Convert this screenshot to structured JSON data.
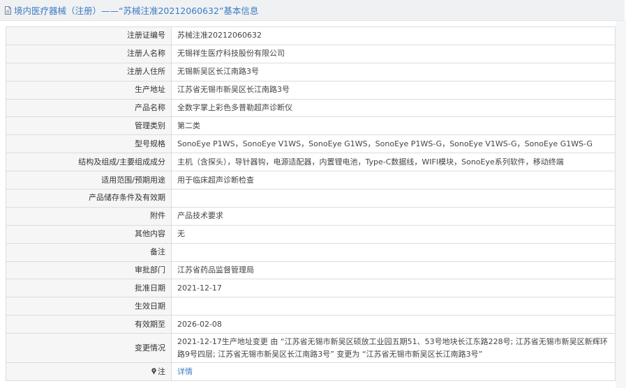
{
  "header": {
    "title": "境内医疗器械（注册）——“苏械注准20212060632”基本信息"
  },
  "rows": [
    {
      "label": "注册证编号",
      "value": "苏械注准20212060632"
    },
    {
      "label": "注册人名称",
      "value": "无锡祥生医疗科技股份有限公司"
    },
    {
      "label": "注册人住所",
      "value": "无锡新吴区长江南路3号"
    },
    {
      "label": "生产地址",
      "value": "江苏省无锡市新吴区长江南路3号"
    },
    {
      "label": "产品名称",
      "value": "全数字掌上彩色多普勒超声诊断仪"
    },
    {
      "label": "管理类别",
      "value": "第二类"
    },
    {
      "label": "型号规格",
      "value": "SonoEye P1WS，SonoEye V1WS，SonoEye G1WS，SonoEye P1WS-G，SonoEye V1WS-G，SonoEye G1WS-G"
    },
    {
      "label": "结构及组成/主要组成成分",
      "value": "主机（含探头），导针器钩，电源适配器，内置锂电池，Type-C数据线，WIFI模块，SonoEye系列软件，移动终端"
    },
    {
      "label": "适用范围/预期用途",
      "value": "用于临床超声诊断检查"
    },
    {
      "label": "产品储存条件及有效期",
      "value": ""
    },
    {
      "label": "附件",
      "value": "产品技术要求"
    },
    {
      "label": "其他内容",
      "value": "无"
    },
    {
      "label": "备注",
      "value": ""
    },
    {
      "label": "审批部门",
      "value": "江苏省药品监督管理局"
    },
    {
      "label": "批准日期",
      "value": "2021-12-17"
    },
    {
      "label": "生效日期",
      "value": ""
    },
    {
      "label": "有效期至",
      "value": "2026-02-08"
    },
    {
      "label": "变更情况",
      "value": "2021-12-17生产地址变更 由 “江苏省无锡市新吴区硕放工业园五期51、53号地块长江东路228号; 江苏省无锡市新吴区新辉环路9号四层; 江苏省无锡市新吴区长江南路3号” 变更为 “江苏省无锡市新吴区长江南路3号”"
    }
  ],
  "note_row": {
    "label": "注",
    "link_text": "详情",
    "icon": "pin-icon"
  },
  "colors": {
    "link": "#3a7bc4",
    "label_bg": "#f6f6f6",
    "border": "#dcdcdc",
    "header_bg": "#f0f1f3"
  }
}
